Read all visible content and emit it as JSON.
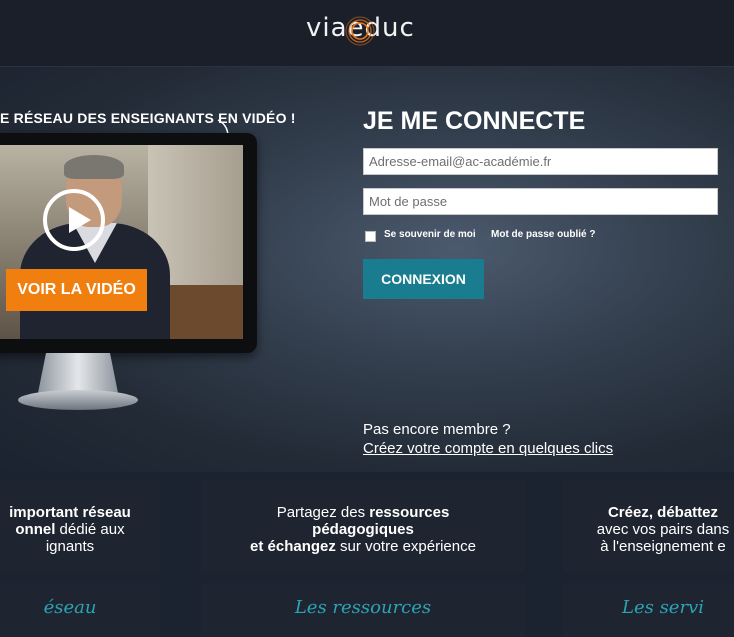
{
  "header": {
    "logo": "viaeduc"
  },
  "hero": {
    "tagline": "E RÉSEAU DES ENSEIGNANTS EN VIDÉO !",
    "video_button": "VOIR LA VIDÉO"
  },
  "login": {
    "title": "JE ME CONNECTE",
    "email_placeholder": "Adresse-email@ac-académie.fr",
    "password_placeholder": "Mot de passe",
    "remember_label": "Se souvenir de moi",
    "forgot_label": "Mot de passe oublié ?",
    "submit_label": "CONNEXION",
    "not_member": "Pas encore membre ?",
    "create_account": "Créez votre compte en quelques clics"
  },
  "features": [
    {
      "lines": [
        [
          {
            "t": "important réseau",
            "b": true
          }
        ],
        [
          {
            "t": "onnel",
            "b": true
          },
          {
            "t": " dédié aux",
            "b": false
          }
        ],
        [
          {
            "t": "ignants",
            "b": false
          }
        ]
      ]
    },
    {
      "lines": [
        [
          {
            "t": "Partagez des ",
            "b": false
          },
          {
            "t": "ressources",
            "b": true
          }
        ],
        [
          {
            "t": "pédagogiques",
            "b": true
          }
        ],
        [
          {
            "t": "et échangez",
            "b": true
          },
          {
            "t": " sur votre expérience",
            "b": false
          }
        ]
      ]
    },
    {
      "lines": [
        [
          {
            "t": "Créez, débattez",
            "b": true
          }
        ],
        [
          {
            "t": "avec vos pairs dans",
            "b": false
          }
        ],
        [
          {
            "t": "à l'enseignement e",
            "b": false
          }
        ]
      ]
    }
  ],
  "sections": [
    "éseau",
    "Les ressources",
    "Les servi"
  ],
  "colors": {
    "accent_orange": "#f07f0f",
    "accent_teal": "#197c8f",
    "section_title": "#2ba3b5"
  },
  "icons": {
    "play": "play-icon",
    "arrow": "curved-arrow-icon"
  }
}
